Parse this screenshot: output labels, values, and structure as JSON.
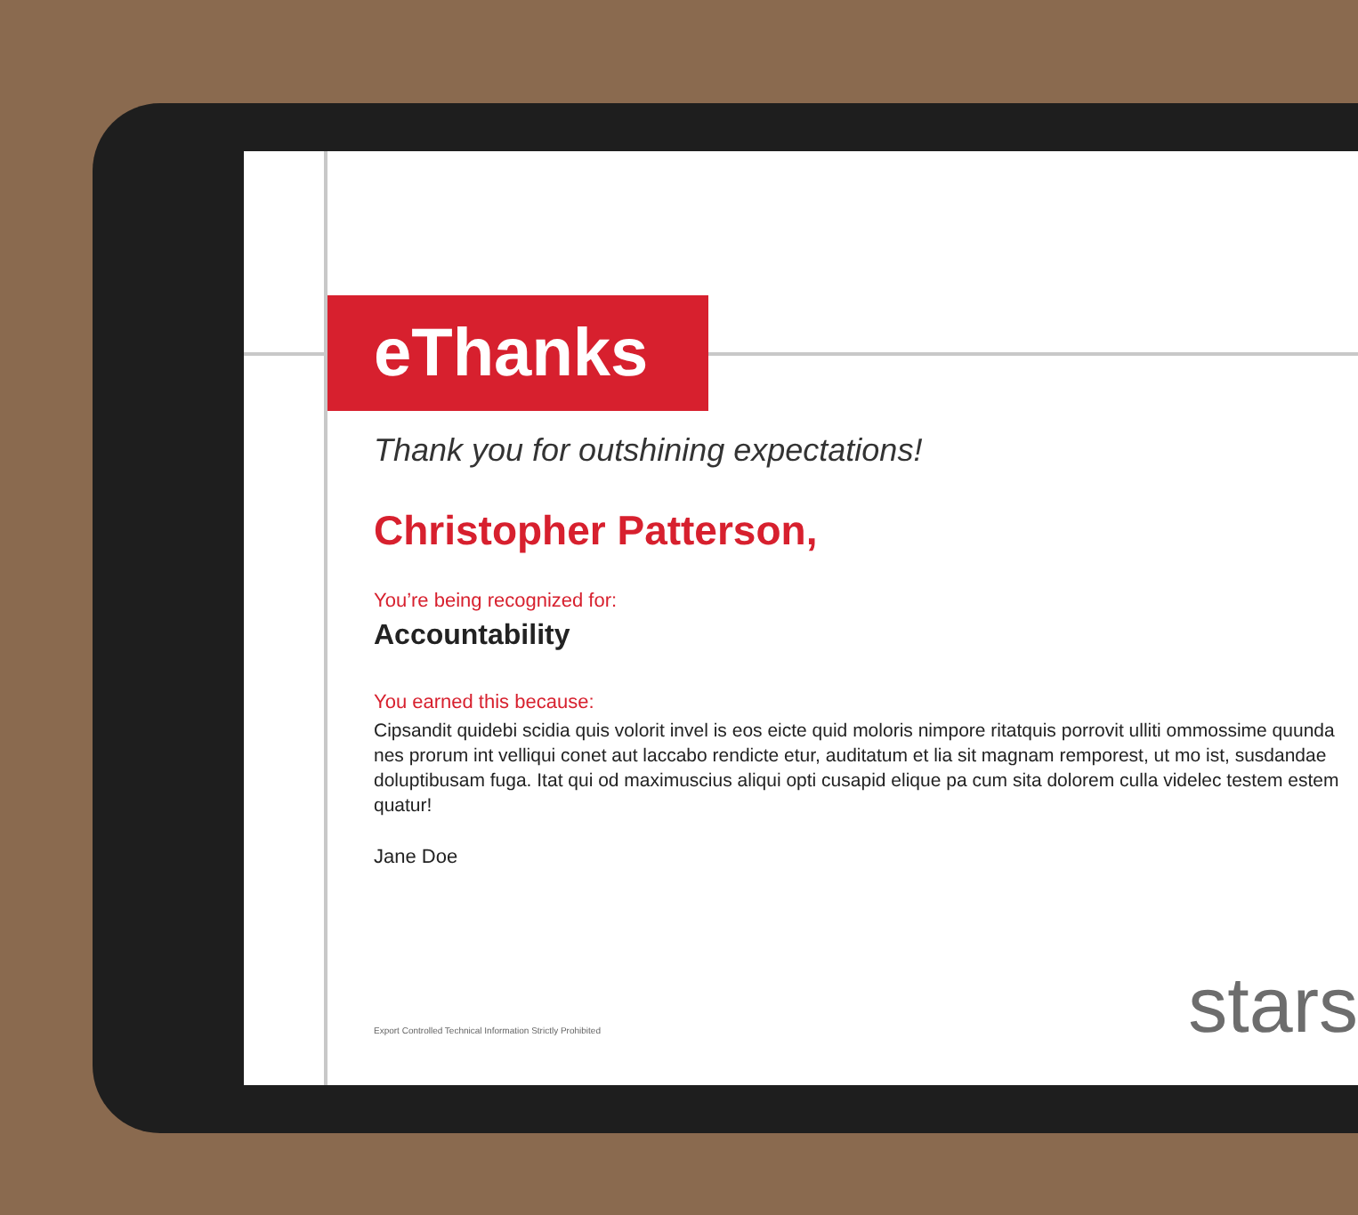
{
  "card": {
    "title": "eThanks",
    "tagline": "Thank you for outshining expectations!",
    "recipient": "Christopher Patterson,",
    "recognized_label": "You’re being recognized for:",
    "value": "Accountability",
    "reason_label": "You earned this because:",
    "reason": "Cipsandit quidebi scidia quis volorit invel is eos eicte quid moloris nimpore ritatquis porrovit ulliti ommossime quunda nes prorum int velliqui conet aut laccabo rendicte etur, auditatum et lia sit magnam remporest, ut mo ist, susdandae doluptibusam fuga. Itat qui od maximuscius aliqui opti cusapid elique pa cum sita dolorem culla videlec testem estem quatur!",
    "signature": "Jane Doe",
    "footer_note": "Export Controlled Technical Information Strictly Prohibited",
    "logo": "stars"
  }
}
